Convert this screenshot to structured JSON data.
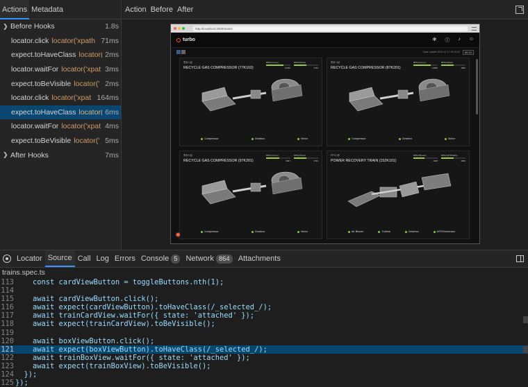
{
  "left_tabs": [
    "Actions",
    "Metadata"
  ],
  "actions": [
    {
      "type": "hook",
      "name": "Before Hooks",
      "locator": "",
      "duration": "1.8s"
    },
    {
      "type": "action",
      "name": "locator.click",
      "locator": "locator('xpath",
      "duration": "71ms"
    },
    {
      "type": "action",
      "name": "expect.toHaveClass",
      "locator": "locator(",
      "duration": "2ms"
    },
    {
      "type": "action",
      "name": "locator.waitFor",
      "locator": "locator('xpat",
      "duration": "3ms"
    },
    {
      "type": "action",
      "name": "expect.toBeVisible",
      "locator": "locator('",
      "duration": "2ms"
    },
    {
      "type": "action",
      "name": "locator.click",
      "locator": "locator('xpat",
      "duration": "164ms"
    },
    {
      "type": "action",
      "name": "expect.toHaveClass",
      "locator": "locator(",
      "duration": "6ms",
      "selected": true
    },
    {
      "type": "action",
      "name": "locator.waitFor",
      "locator": "locator('xpat",
      "duration": "4ms"
    },
    {
      "type": "action",
      "name": "expect.toBeVisible",
      "locator": "locator('",
      "duration": "5ms"
    },
    {
      "type": "hook",
      "name": "After Hooks",
      "locator": "",
      "duration": "7ms"
    }
  ],
  "snapshot_tabs": [
    "Action",
    "Before",
    "After"
  ],
  "snapshot": {
    "url": "http://localhost:3000/trains/",
    "logo": "turbo",
    "update_text": "Data Update  2023-12-17 15:30:22",
    "clock": "00:10",
    "cards": [
      {
        "sub": "원동시설",
        "title": "RECYCLE GAS COMPRESSOR (77K102)",
        "metrics": [
          {
            "label": "RPM (Comp.)",
            "value": "13780",
            "fill": 0.7
          },
          {
            "label": "RPM (Motor)",
            "value": "1784",
            "fill": 0.5
          }
        ],
        "legend": [
          "Compressor",
          "Gearbox",
          "Motor"
        ]
      },
      {
        "sub": "원동시설",
        "title": "RECYCLE GAS COMPRESSOR (87K201)",
        "metrics": [
          {
            "label": "RPM (Comp.)",
            "value": "14089",
            "fill": 0.7
          },
          {
            "label": "RPM (Motor)",
            "value": "1800",
            "fill": 0.5
          }
        ],
        "legend": [
          "Compressor",
          "Gearbox",
          "Motor"
        ]
      },
      {
        "sub": "원동시설",
        "title": "RECYCLE GAS COMPRESSOR (97K201)",
        "metrics": [
          {
            "label": "RPM (Comp.)",
            "value": "9847",
            "fill": 0.55
          },
          {
            "label": "RPM (Motor)",
            "value": "1794",
            "fill": 0.5
          }
        ],
        "legend": [
          "Compressor",
          "Gearbox",
          "Motor"
        ]
      },
      {
        "sub": "RFCC동",
        "title": "POWER RECOVERY TRAIN (152K101)",
        "metrics": [
          {
            "label": "RPM (Blower)",
            "value": "4028",
            "fill": 0.45
          },
          {
            "label": "RPM (MTR/GEN)",
            "value": "1800",
            "fill": 0.5
          }
        ],
        "legend": [
          "Air Blower",
          "Turbine",
          "Gearbox",
          "MTR/Generator"
        ]
      }
    ]
  },
  "bottom_tabs": [
    {
      "label": "Locator"
    },
    {
      "label": "Source",
      "active": true
    },
    {
      "label": "Call"
    },
    {
      "label": "Log"
    },
    {
      "label": "Errors"
    },
    {
      "label": "Console",
      "badge": "5"
    },
    {
      "label": "Network",
      "badge": "864"
    },
    {
      "label": "Attachments"
    }
  ],
  "file_name": "trains.spec.ts",
  "code_lines": [
    {
      "n": "113",
      "text": "    const cardViewButton = toggleButtons.nth(1);"
    },
    {
      "n": "114",
      "text": ""
    },
    {
      "n": "115",
      "text": "    await cardViewButton.click();"
    },
    {
      "n": "116",
      "text": "    await expect(cardViewButton).toHaveClass(/_selected_/);"
    },
    {
      "n": "117",
      "text": "    await trainCardView.waitFor({ state: 'attached' });"
    },
    {
      "n": "118",
      "text": "    await expect(trainCardView).toBeVisible();"
    },
    {
      "n": "119",
      "text": ""
    },
    {
      "n": "120",
      "text": "    await boxViewButton.click();"
    },
    {
      "n": "121",
      "text": "    await expect(boxViewButton).toHaveClass(/_selected_/);",
      "highlight": true
    },
    {
      "n": "122",
      "text": "    await trainBoxView.waitFor({ state: 'attached' });"
    },
    {
      "n": "123",
      "text": "    await expect(trainBoxView).toBeVisible();"
    },
    {
      "n": "124",
      "text": "  });"
    },
    {
      "n": "125",
      "text": "});"
    }
  ]
}
